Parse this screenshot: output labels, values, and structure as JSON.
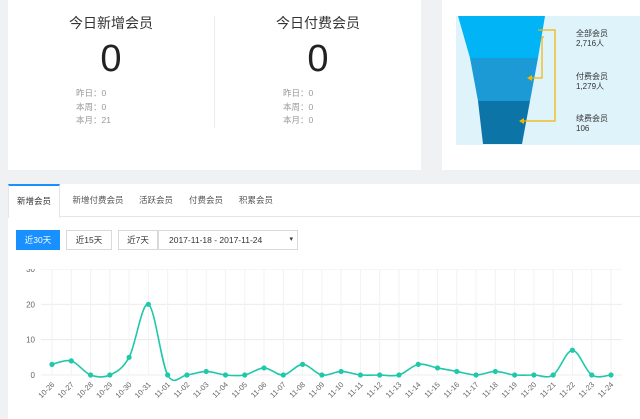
{
  "stats": {
    "new_members": {
      "title": "今日新增会员",
      "value": "0",
      "yesterday": "昨日：0",
      "week": "本周：0",
      "month": "本月：21"
    },
    "paid_members": {
      "title": "今日付费会员",
      "value": "0",
      "yesterday": "昨日：0",
      "week": "本周：0",
      "month": "本月：0"
    }
  },
  "funnel": {
    "levels": [
      {
        "label": "全部会员",
        "count": "2,716人",
        "color": "#00b4f5"
      },
      {
        "label": "付费会员",
        "count": "1,279人",
        "color": "#1b9ad6"
      },
      {
        "label": "续费会员",
        "count": "106",
        "color": "#0d74a8"
      }
    ],
    "arrow_color": "#f5b400",
    "panel_color": "#dff3fb"
  },
  "tabs": [
    "新增会员",
    "新增付费会员",
    "活跃会员",
    "付费会员",
    "积累会员"
  ],
  "filters": {
    "buttons": [
      "近30天",
      "近15天",
      "近7天"
    ],
    "date_range": "2017-11-18 - 2017-11-24",
    "caret": "▾"
  },
  "chart_data": {
    "type": "line",
    "x": [
      "10-26",
      "10-27",
      "10-28",
      "10-29",
      "10-30",
      "10-31",
      "11-01",
      "11-02",
      "11-03",
      "11-04",
      "11-05",
      "11-06",
      "11-07",
      "11-08",
      "11-09",
      "11-10",
      "11-11",
      "11-12",
      "11-13",
      "11-14",
      "11-15",
      "11-16",
      "11-17",
      "11-18",
      "11-19",
      "11-20",
      "11-21",
      "11-22",
      "11-23",
      "11-24"
    ],
    "values": [
      3,
      4,
      0,
      0,
      5,
      20,
      0,
      0,
      1,
      0,
      0,
      2,
      0,
      3,
      0,
      1,
      0,
      0,
      0,
      3,
      2,
      1,
      0,
      1,
      0,
      0,
      0,
      7,
      0,
      0
    ],
    "yticks": [
      "0",
      "10",
      "20",
      "30"
    ],
    "ylim": [
      0,
      30
    ],
    "color": "#1fc8a8",
    "grid": true
  }
}
